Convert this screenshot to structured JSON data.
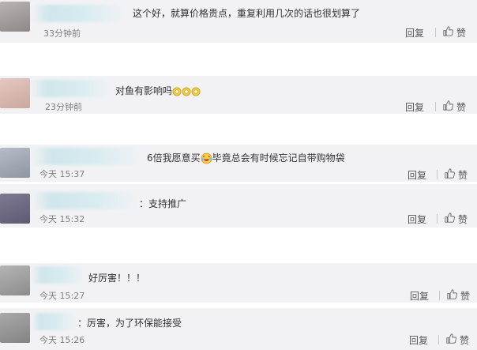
{
  "comments": [
    {
      "text": "这个好，就算价格贵点，重复利用几次的话也很划算了",
      "time": "33分钟前",
      "reply_label": "回复",
      "like_label": "赞",
      "avatar_icon": "user-avatar-icon"
    },
    {
      "text": "对鱼有影响吗",
      "time": "23分钟前",
      "reply_label": "回复",
      "like_label": "赞",
      "emoji": "ok-hands-emoji"
    },
    {
      "text_before": "6倍我愿意买",
      "text_after": "毕竟总会有时候忘记自带购物袋",
      "time": "今天 15:37",
      "reply_label": "回复",
      "like_label": "赞",
      "emoji": "laughing-tears-emoji"
    },
    {
      "text": "：支持推广",
      "time": "今天 15:32",
      "reply_label": "回复",
      "like_label": "赞"
    },
    {
      "text": "好厉害！！！",
      "time": "今天 15:27",
      "reply_label": "回复",
      "like_label": "赞"
    },
    {
      "text": "：厉害，为了环保能接受",
      "time": "今天 15:26",
      "reply_label": "回复",
      "like_label": "赞"
    }
  ],
  "colors": {
    "block_bg": "#f2f2f5",
    "text": "#333333",
    "muted": "#808080",
    "blur_accent": "#cfe6ec"
  }
}
